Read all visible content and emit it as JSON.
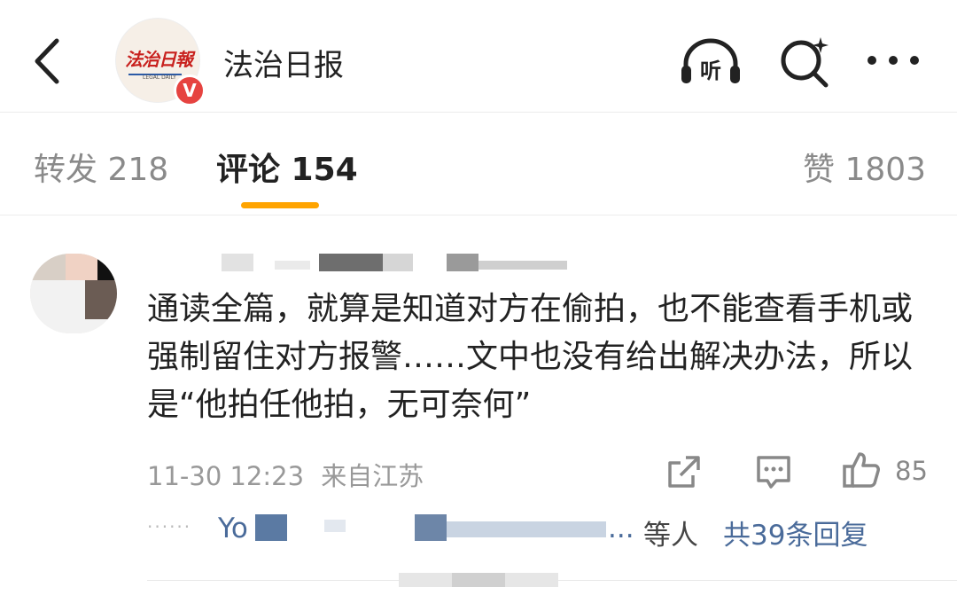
{
  "header": {
    "account_name": "法治日报",
    "logo_text": "法治日報",
    "logo_subtext": "LEGAL DAILY",
    "verified_mark": "V",
    "icons": [
      "back-icon",
      "listen-icon",
      "search-icon",
      "more-icon"
    ],
    "listen_label": "听"
  },
  "tabs": [
    {
      "label": "转发 218",
      "active": false
    },
    {
      "label": "评论 154",
      "active": true
    },
    {
      "label": "赞 1803",
      "active": false
    }
  ],
  "accent_color": "#ffa400",
  "link_color": "#4a6b9a",
  "comment": {
    "text": "通读全篇，就算是知道对方在偷拍，也不能查看手机或强制留住对方报警……文中也没有给出解决办法，所以是“他拍任他拍，无可奈何”",
    "time": "11-30 12:23",
    "location": "来自江苏",
    "likes": "85",
    "replies": {
      "names_visible": "Yo",
      "names_visible_2": "...",
      "suffix": "等人",
      "total": "共39条回复"
    }
  }
}
